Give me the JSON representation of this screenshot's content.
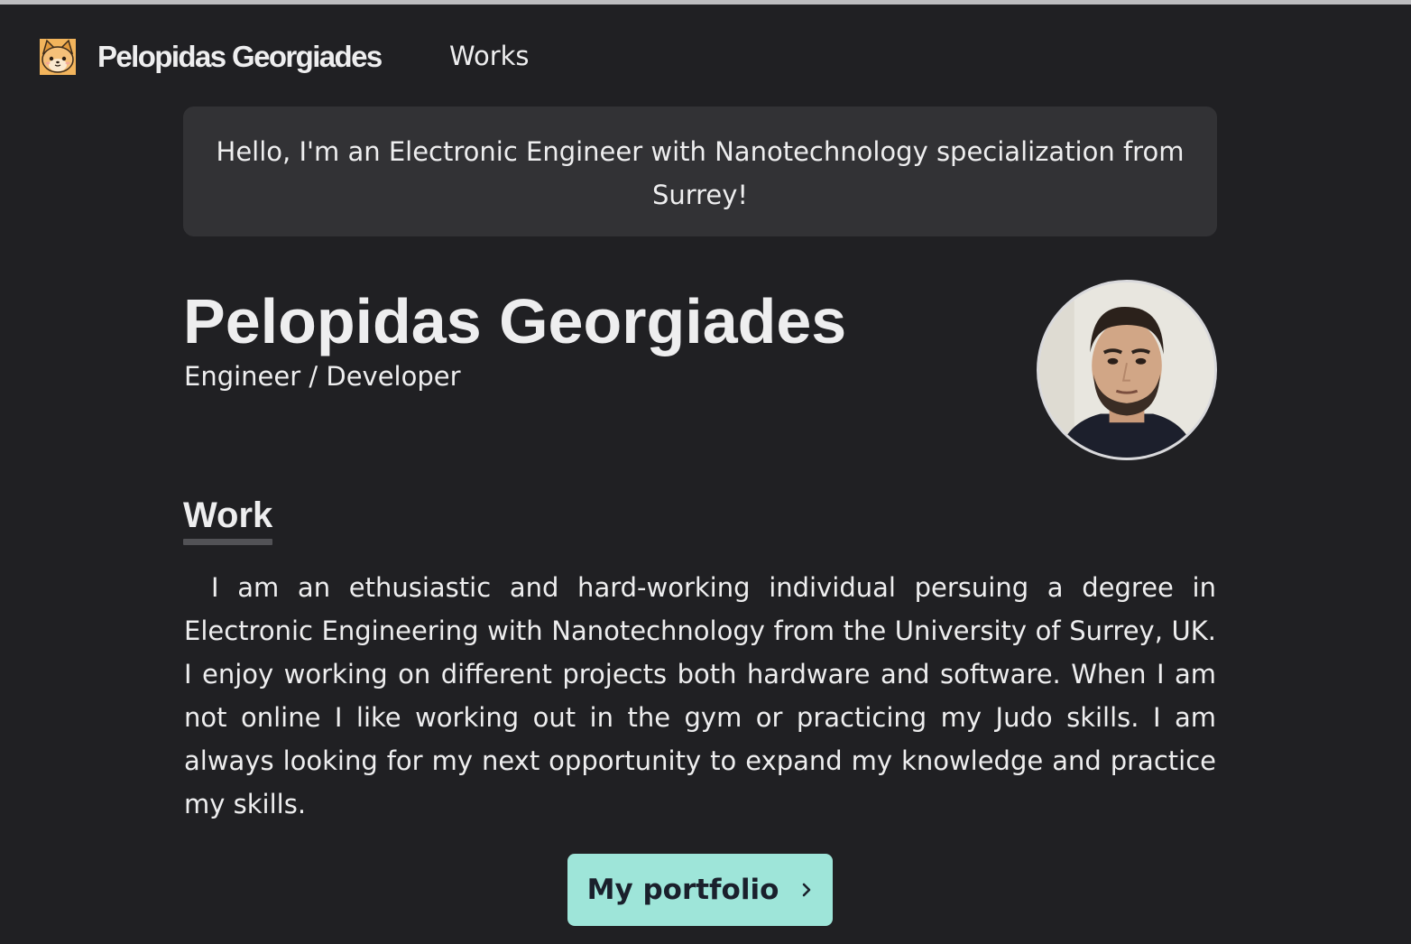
{
  "header": {
    "logo_icon": "cat-face-icon",
    "site_name": "Pelopidas Georgiades",
    "nav": {
      "works_label": "Works"
    }
  },
  "intro": {
    "hello_text": "Hello, I'm an Electronic Engineer with Nanotechnology specialization from Surrey!"
  },
  "profile": {
    "name": "Pelopidas Georgiades",
    "role": "Engineer / Developer",
    "avatar_icon": "profile-photo"
  },
  "work_section": {
    "heading": "Work",
    "bio": "I am an ethusiastic and hard-working individual persuing a degree in Electronic Engineering with Nanotechnology from the University of Surrey, UK. I enjoy working on different projects both hardware and software. When I am not online I like working out in the gym or practicing my Judo skills. I am always looking for my next opportunity to expand my knowledge and practice my skills.",
    "button_label": "My portfolio",
    "button_icon": "chevron-right-icon"
  },
  "colors": {
    "background": "#202023",
    "card": "#323235",
    "text": "#eeeeef",
    "accent_button": "#9ee5d9",
    "underline": "#525256"
  }
}
